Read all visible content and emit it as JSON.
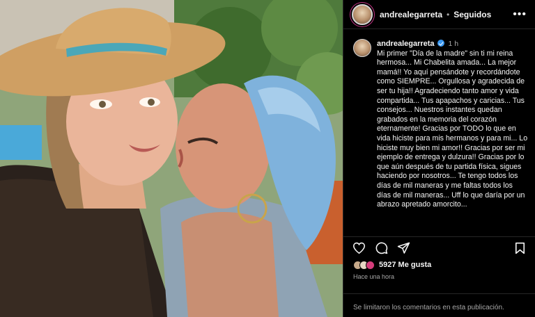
{
  "post": {
    "username": "andrealegarreta",
    "follow_status": "Seguidos",
    "separator": "•",
    "more_label": "•••",
    "time_ago_short": "1 h",
    "caption": "Mi primer \"Día de la madre\" sin ti mi reina hermosa... Mi Chabelita amada... La mejor mamá!! Yo aquí pensándote y recordándote como SIEMPRE... Orgullosa y agradecida de ser tu hija!! Agradeciendo tanto amor y vida compartida... Tus apapachos y caricias... Tus consejos... Nuestros instantes quedan grabados en la memoria del corazón eternamente! Gracias por TODO lo que en vida hiciste para mis hermanos y para mi... Lo hiciste muy bien mi amor!! Gracias por ser mi ejemplo de entrega y dulzura!! Gracias por lo que aún después de tu partida física, sigues haciendo por nosotros... Te tengo todos los días de mil maneras y me faltas todos los días de mil maneras... Uff lo que daría por un abrazo apretado amorcito...",
    "likes_count": "5927",
    "likes_label": "Me gusta",
    "time_ago_long": "Hace una hora",
    "comments_disabled": "Se limitaron los comentarios en esta publicación."
  },
  "icons": {
    "like": "heart-icon",
    "comment": "comment-icon",
    "share": "share-icon",
    "save": "bookmark-icon",
    "verified": "verified-badge-icon"
  },
  "colors": {
    "background": "#000000",
    "text": "#f5f5f5",
    "secondary_text": "#a8a8a8",
    "verified": "#3897f0",
    "divider": "#262626"
  }
}
